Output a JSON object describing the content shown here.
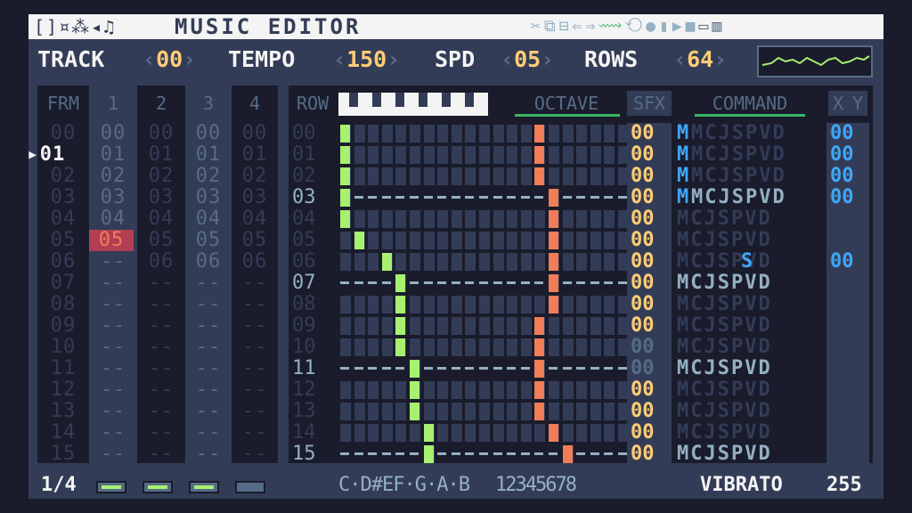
{
  "topbar": {
    "left_icons": "[]¤⁂◂♫",
    "title": "MUSIC EDITOR",
    "right_icons_a": "✂⧉⊟⇐⇒",
    "right_icons_b": "⟿",
    "right_icons_c": "⟲●▮▶■",
    "right_icons_d": "▭▥"
  },
  "header": {
    "track_label": "TRACK",
    "track_value": "00",
    "tempo_label": "TEMPO",
    "tempo_value": "150",
    "spd_label": "SPD",
    "spd_value": "05",
    "rows_label": "ROWS",
    "rows_value": "64",
    "lbr": "‹",
    "rbr": "›"
  },
  "frames": {
    "frm_label": "FRM",
    "channels": [
      "1",
      "2",
      "3",
      "4"
    ],
    "current_frame": "01",
    "highlight_cell": "05",
    "rows": [
      "00",
      "01",
      "02",
      "03",
      "04",
      "05",
      "06",
      "07",
      "08",
      "09",
      "10",
      "11",
      "12",
      "13",
      "14",
      "15"
    ],
    "dash": "--"
  },
  "pattern": {
    "row_label": "ROW",
    "octave_label": "OCTAVE",
    "sfx_label": "SFX",
    "command_label": "COMMAND",
    "x_label": "X",
    "y_label": "Y",
    "rows": [
      "00",
      "01",
      "02",
      "03",
      "04",
      "05",
      "06",
      "07",
      "08",
      "09",
      "10",
      "11",
      "12",
      "13",
      "14",
      "15"
    ],
    "sfx_value": "00",
    "command_text": "MCJSPVD",
    "command_m": "M",
    "command_s": "S",
    "xy_value": "00"
  },
  "footer": {
    "page": "1/4",
    "notes": "C·D#EF·G·A·B",
    "octaves": "12345678",
    "command_name": "VIBRATO",
    "command_value": "255"
  }
}
